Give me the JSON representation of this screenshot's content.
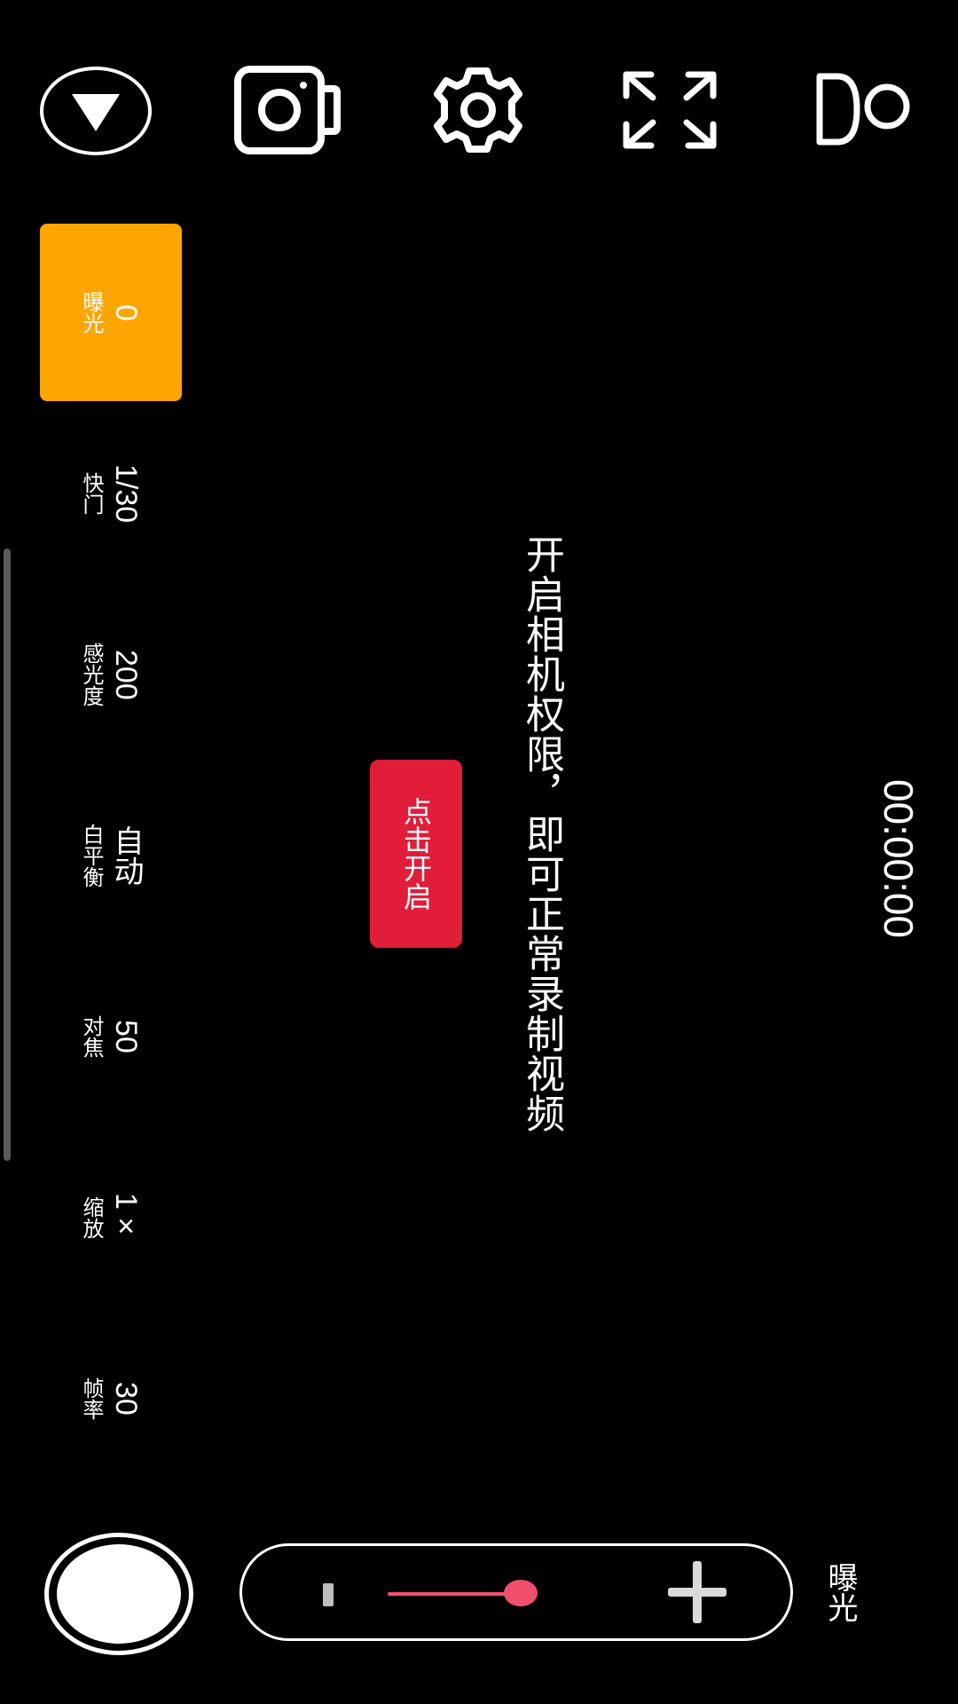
{
  "toolbar": {
    "items": [
      "play-triangle-icon",
      "camera-icon",
      "gear-icon",
      "expand-arrows-icon",
      "toggle-capsule-icon"
    ]
  },
  "params": [
    {
      "value": "0",
      "label": "曝光",
      "active": true
    },
    {
      "value": "1/30",
      "label": "快门",
      "active": false
    },
    {
      "value": "200",
      "label": "感光度",
      "active": false
    },
    {
      "value": "自动",
      "label": "白平衡",
      "active": false
    },
    {
      "value": "50",
      "label": "对焦",
      "active": false
    },
    {
      "value": "1×",
      "label": "缩放",
      "active": false
    },
    {
      "value": "30",
      "label": "帧率",
      "active": false
    }
  ],
  "center": {
    "permission_text": "开启相机权限，即可正常录制视频",
    "open_button": "点击开启",
    "timer": "00:00:00"
  },
  "slider": {
    "label": "曝光",
    "level": 0.6
  },
  "colors": {
    "accent": "#FFA500",
    "button": "#E11D3A",
    "slider": "#F0506E",
    "background": "#000000"
  }
}
